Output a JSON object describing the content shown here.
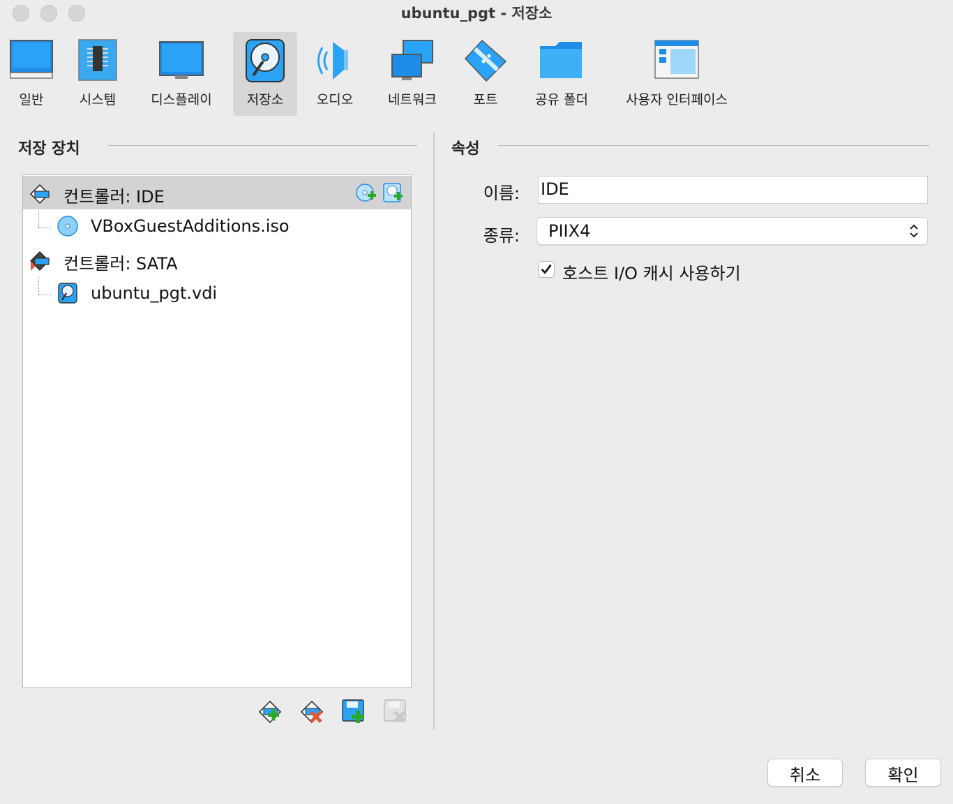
{
  "window": {
    "title": "ubuntu_pgt - 저장소"
  },
  "toolbar": {
    "items": [
      {
        "label": "일반",
        "icon": "monitor-general-icon"
      },
      {
        "label": "시스템",
        "icon": "chip-icon"
      },
      {
        "label": "디스플레이",
        "icon": "display-icon"
      },
      {
        "label": "저장소",
        "icon": "storage-disk-icon",
        "selected": true
      },
      {
        "label": "오디오",
        "icon": "speaker-icon"
      },
      {
        "label": "네트워크",
        "icon": "network-icon"
      },
      {
        "label": "포트",
        "icon": "serial-port-icon"
      },
      {
        "label": "공유 폴더",
        "icon": "shared-folder-icon"
      },
      {
        "label": "사용자 인터페이스",
        "icon": "user-interface-icon"
      }
    ]
  },
  "storage": {
    "heading": "저장 장치",
    "tree": [
      {
        "label": "컨트롤러: IDE",
        "type": "controller",
        "icon": "ide-controller-icon",
        "selected": true
      },
      {
        "label": "VBoxGuestAdditions.iso",
        "type": "optical",
        "icon": "optical-disc-icon"
      },
      {
        "label": "컨트롤러: SATA",
        "type": "controller",
        "icon": "sata-controller-icon"
      },
      {
        "label": "ubuntu_pgt.vdi",
        "type": "harddisk",
        "icon": "hard-disk-icon"
      }
    ],
    "row_actions": [
      "add-optical-drive-icon",
      "add-hard-disk-icon"
    ],
    "bottom_actions": [
      "add-controller-icon",
      "remove-controller-icon",
      "add-attachment-icon",
      "remove-attachment-icon"
    ]
  },
  "attributes": {
    "heading": "속성",
    "name_label": "이름:",
    "name_value": "IDE",
    "type_label": "종류:",
    "type_value": "PIIX4",
    "host_cache_label": "호스트 I/O 캐시 사용하기",
    "host_cache_checked": true
  },
  "buttons": {
    "cancel": "취소",
    "ok": "확인"
  },
  "colors": {
    "accent": "#2a9ff0",
    "selection": "#d3d3d3",
    "icon_blue": "#1e88e5"
  }
}
